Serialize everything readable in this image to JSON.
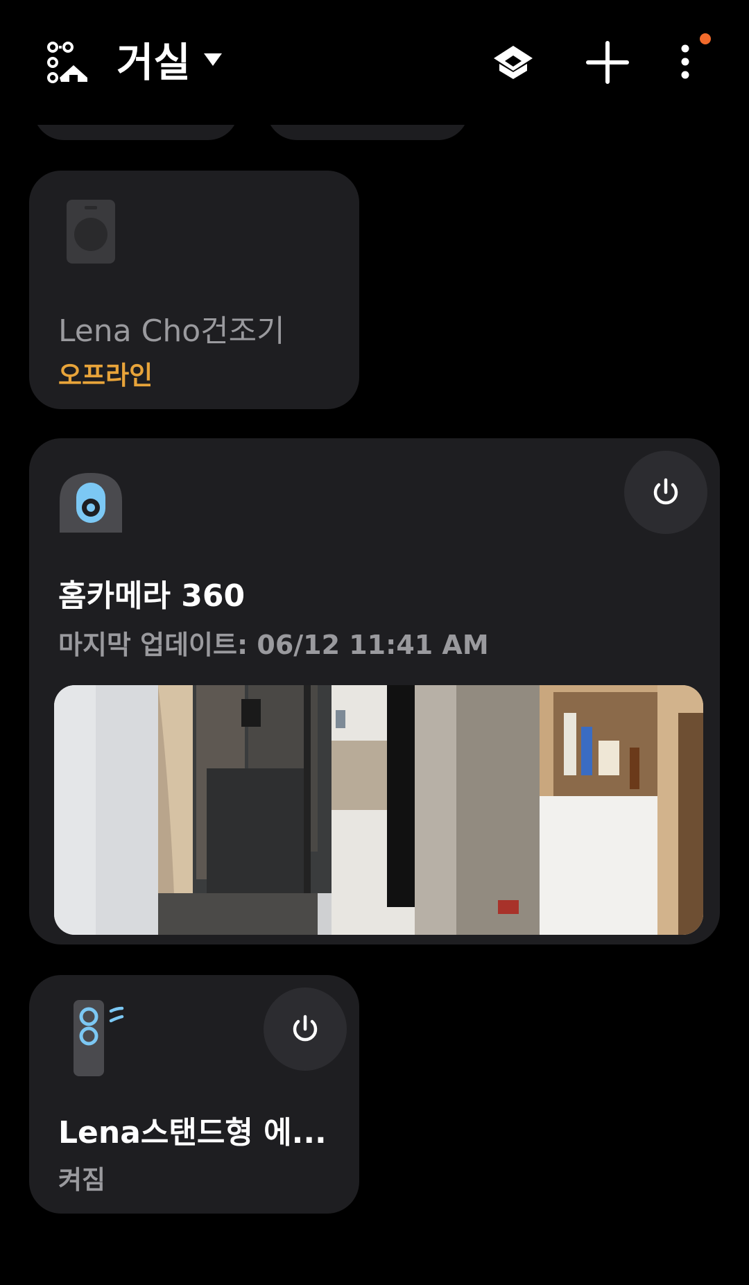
{
  "header": {
    "location": "거실",
    "home_icon": "smartthings-home-icon",
    "dropdown_icon": "caret-down-icon",
    "actions": [
      {
        "name": "home-view-icon"
      },
      {
        "name": "plus-icon"
      },
      {
        "name": "more-vertical-icon",
        "has_notification": true
      }
    ],
    "notification_color": "#f26a2b"
  },
  "devices": [
    {
      "name": "Lena Cho건조기",
      "status": "오프라인",
      "status_color": "#e8a43a",
      "icon": "dryer-icon"
    },
    {
      "name": "홈카메라 360",
      "status": "마지막 업데이트: 06/12 11:41 AM",
      "icon": "home-camera-icon",
      "has_power_button": true,
      "has_camera_preview": true
    },
    {
      "name": "Lena스탠드형 에...",
      "status": "켜짐",
      "icon": "air-purifier-icon",
      "has_power_button": true
    }
  ],
  "colors": {
    "background": "#000000",
    "card": "#1e1e21",
    "accent_blue": "#7cc8f4",
    "offline": "#e8a43a",
    "secondary_text": "#9a9a9e"
  }
}
